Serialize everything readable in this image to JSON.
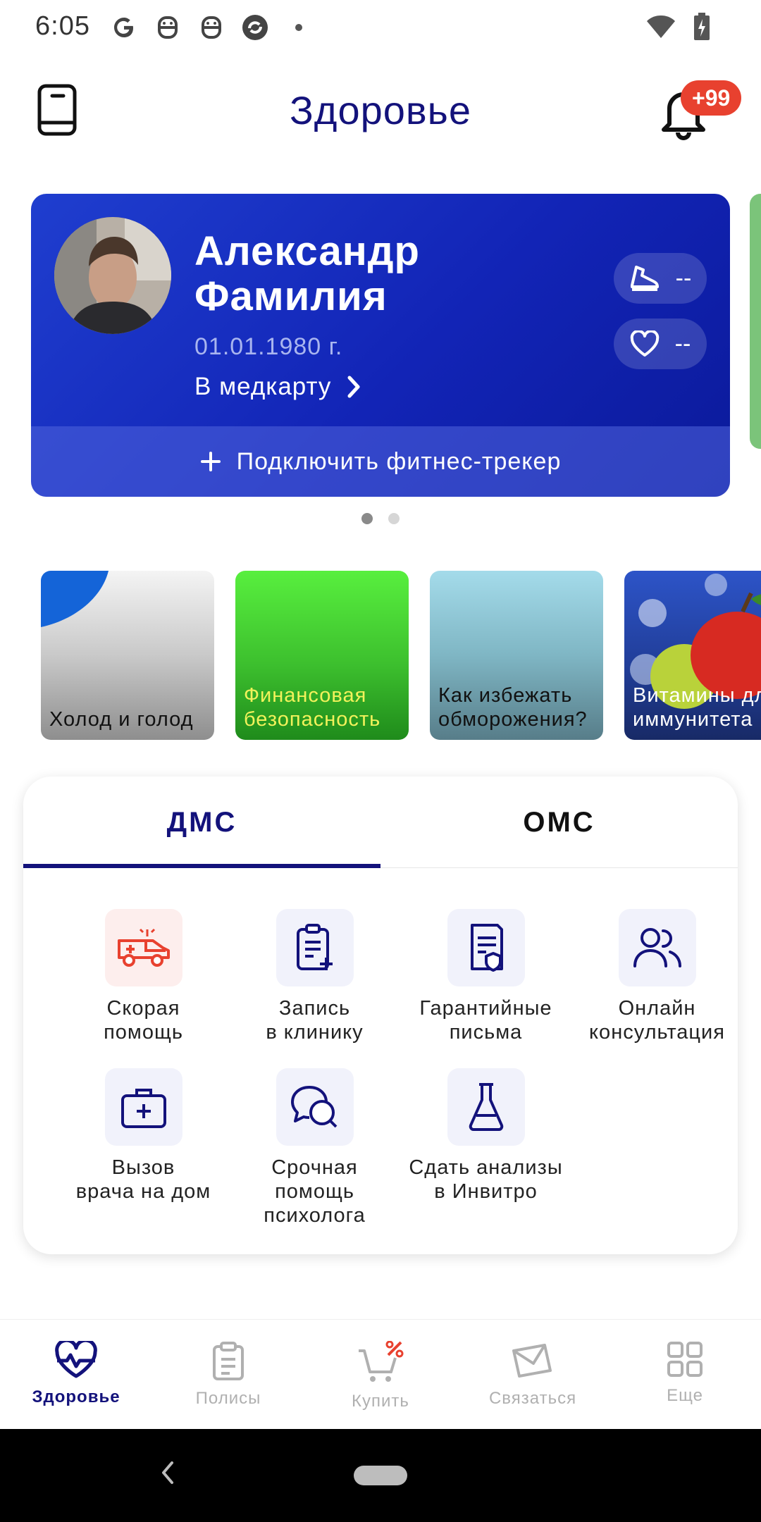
{
  "status_bar": {
    "time": "6:05",
    "icons": [
      "google-icon",
      "robot-icon",
      "robot-icon",
      "refresh-app-icon",
      "dot-icon"
    ],
    "right_icons": [
      "wifi-icon",
      "battery-charging-icon"
    ]
  },
  "header": {
    "title": "Здоровье",
    "badge": "+99"
  },
  "profile": {
    "name": "Александр Фамилия",
    "birth_date": "01.01.1980 г.",
    "medcard_link": "В медкарту",
    "steps_value": "--",
    "pulse_value": "--",
    "fitness_tracker": "Подключить фитнес-трекер"
  },
  "carousel": {
    "pages": 2,
    "active": 0
  },
  "stories": [
    {
      "label": "Холод и голод"
    },
    {
      "label": "Финансовая\nбезопасность"
    },
    {
      "label": "Как избежать\nобморожения?"
    },
    {
      "label": "Витамины для\nиммунитета"
    }
  ],
  "insurance": {
    "tabs": [
      {
        "label": "ДМС"
      },
      {
        "label": "ОМС"
      }
    ],
    "active_tab": "ДМС",
    "services": [
      {
        "label": "Скорая\nпомощь",
        "icon": "ambulance-icon"
      },
      {
        "label": "Запись\nв клинику",
        "icon": "clipboard-plus-icon"
      },
      {
        "label": "Гарантийные\nписьма",
        "icon": "document-shield-icon"
      },
      {
        "label": "Онлайн\nконсультация",
        "icon": "people-icon"
      },
      {
        "label": "Вызов\nврача на дом",
        "icon": "medical-bag-icon"
      },
      {
        "label": "Срочная\nпомощь\nпсихолога",
        "icon": "chat-bubbles-icon"
      },
      {
        "label": "Сдать анализы\nв Инвитро",
        "icon": "flask-icon"
      }
    ]
  },
  "bottom_nav": [
    {
      "label": "Здоровье",
      "icon": "heart-pulse-icon",
      "active": true
    },
    {
      "label": "Полисы",
      "icon": "clipboard-icon",
      "active": false
    },
    {
      "label": "Купить",
      "icon": "cart-percent-icon",
      "active": false
    },
    {
      "label": "Связаться",
      "icon": "envelope-icon",
      "active": false
    },
    {
      "label": "Еще",
      "icon": "grid-icon",
      "active": false
    }
  ],
  "colors": {
    "brand": "#13127b",
    "card_gradient_start": "#1f3ecf",
    "card_gradient_end": "#0b1a9a",
    "badge": "#e8412f",
    "emergency": "#e8412f"
  }
}
